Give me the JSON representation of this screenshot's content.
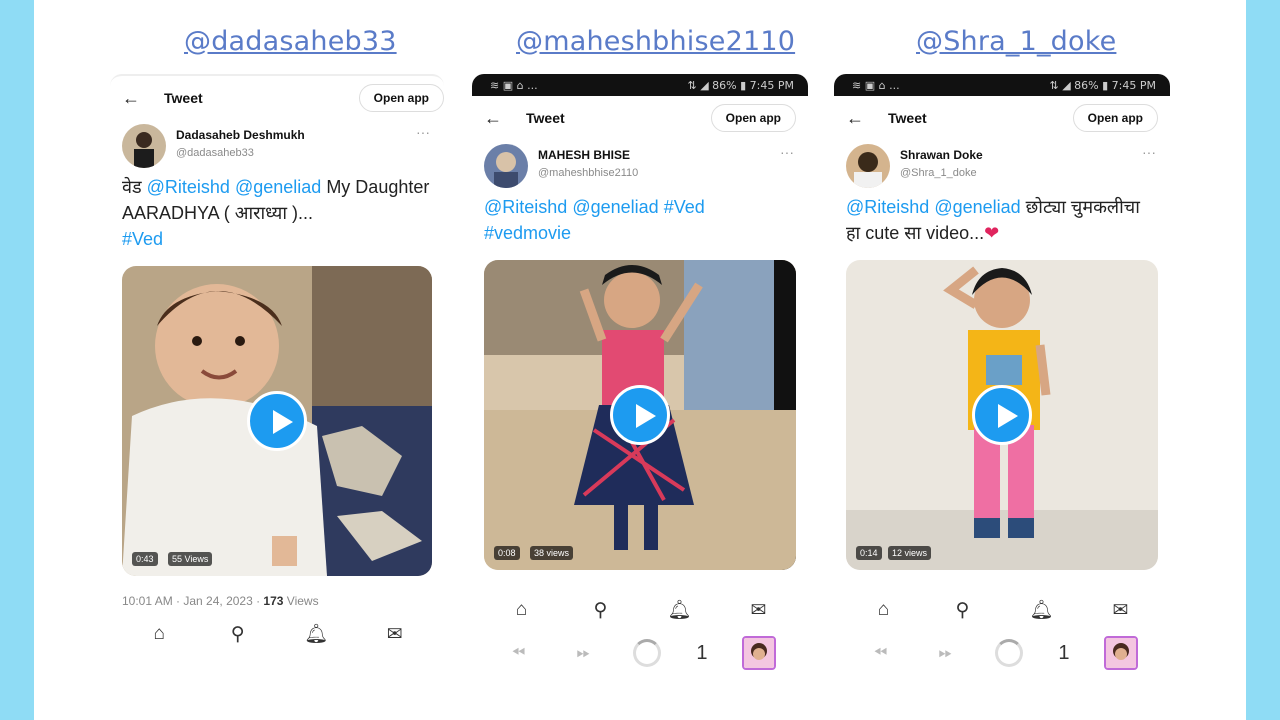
{
  "handles": [
    "@dadasaheb33",
    "@maheshbhise2110",
    "@Shra_1_doke"
  ],
  "common": {
    "back": "←",
    "tweet_label": "Tweet",
    "open_app": "Open app",
    "more": "···",
    "tab_count": "1"
  },
  "status_bar": {
    "left": "≋ ▣ ⌂ ...",
    "right": "⇅ ◢ 86% ▮ 7:45 PM"
  },
  "tweets": [
    {
      "display_name": "Dadasaheb Deshmukh",
      "username": "@dadasaheb33",
      "text_prefix": "वेड ",
      "mention1": "@Riteishd",
      "mention2": "@geneliad",
      "text_mid": " My Daughter AARADHYA ( आराध्या )...",
      "hashtag": "#Ved",
      "duration": "0:43",
      "views_badge": "55 Views",
      "time": "10:01 AM · Jan 24, 2023 · ",
      "views_count": "173",
      "views_word": " Views"
    },
    {
      "display_name": "MAHESH BHISE",
      "username": "@maheshbhise2110",
      "mention1": "@Riteishd",
      "mention2": "@geneliad",
      "hashtag1": "#Ved",
      "hashtag2": "#vedmovie",
      "duration": "0:08",
      "views_badge": "38 views"
    },
    {
      "display_name": "Shrawan Doke",
      "username": "@Shra_1_doke",
      "mention1": "@Riteishd",
      "mention2": "@geneliad",
      "text_rest": " छोट्या चुमकलीचा हा cute सा video...",
      "heart": "❤",
      "duration": "0:14",
      "views_badge": "12 views"
    }
  ],
  "nav_icons": [
    "home-icon",
    "search-icon",
    "bell-icon",
    "mail-icon"
  ],
  "colors": {
    "accent": "#1d9bf0",
    "handle": "#5a7bc8",
    "background": "#8fdcf5",
    "heart": "#e0245e"
  }
}
